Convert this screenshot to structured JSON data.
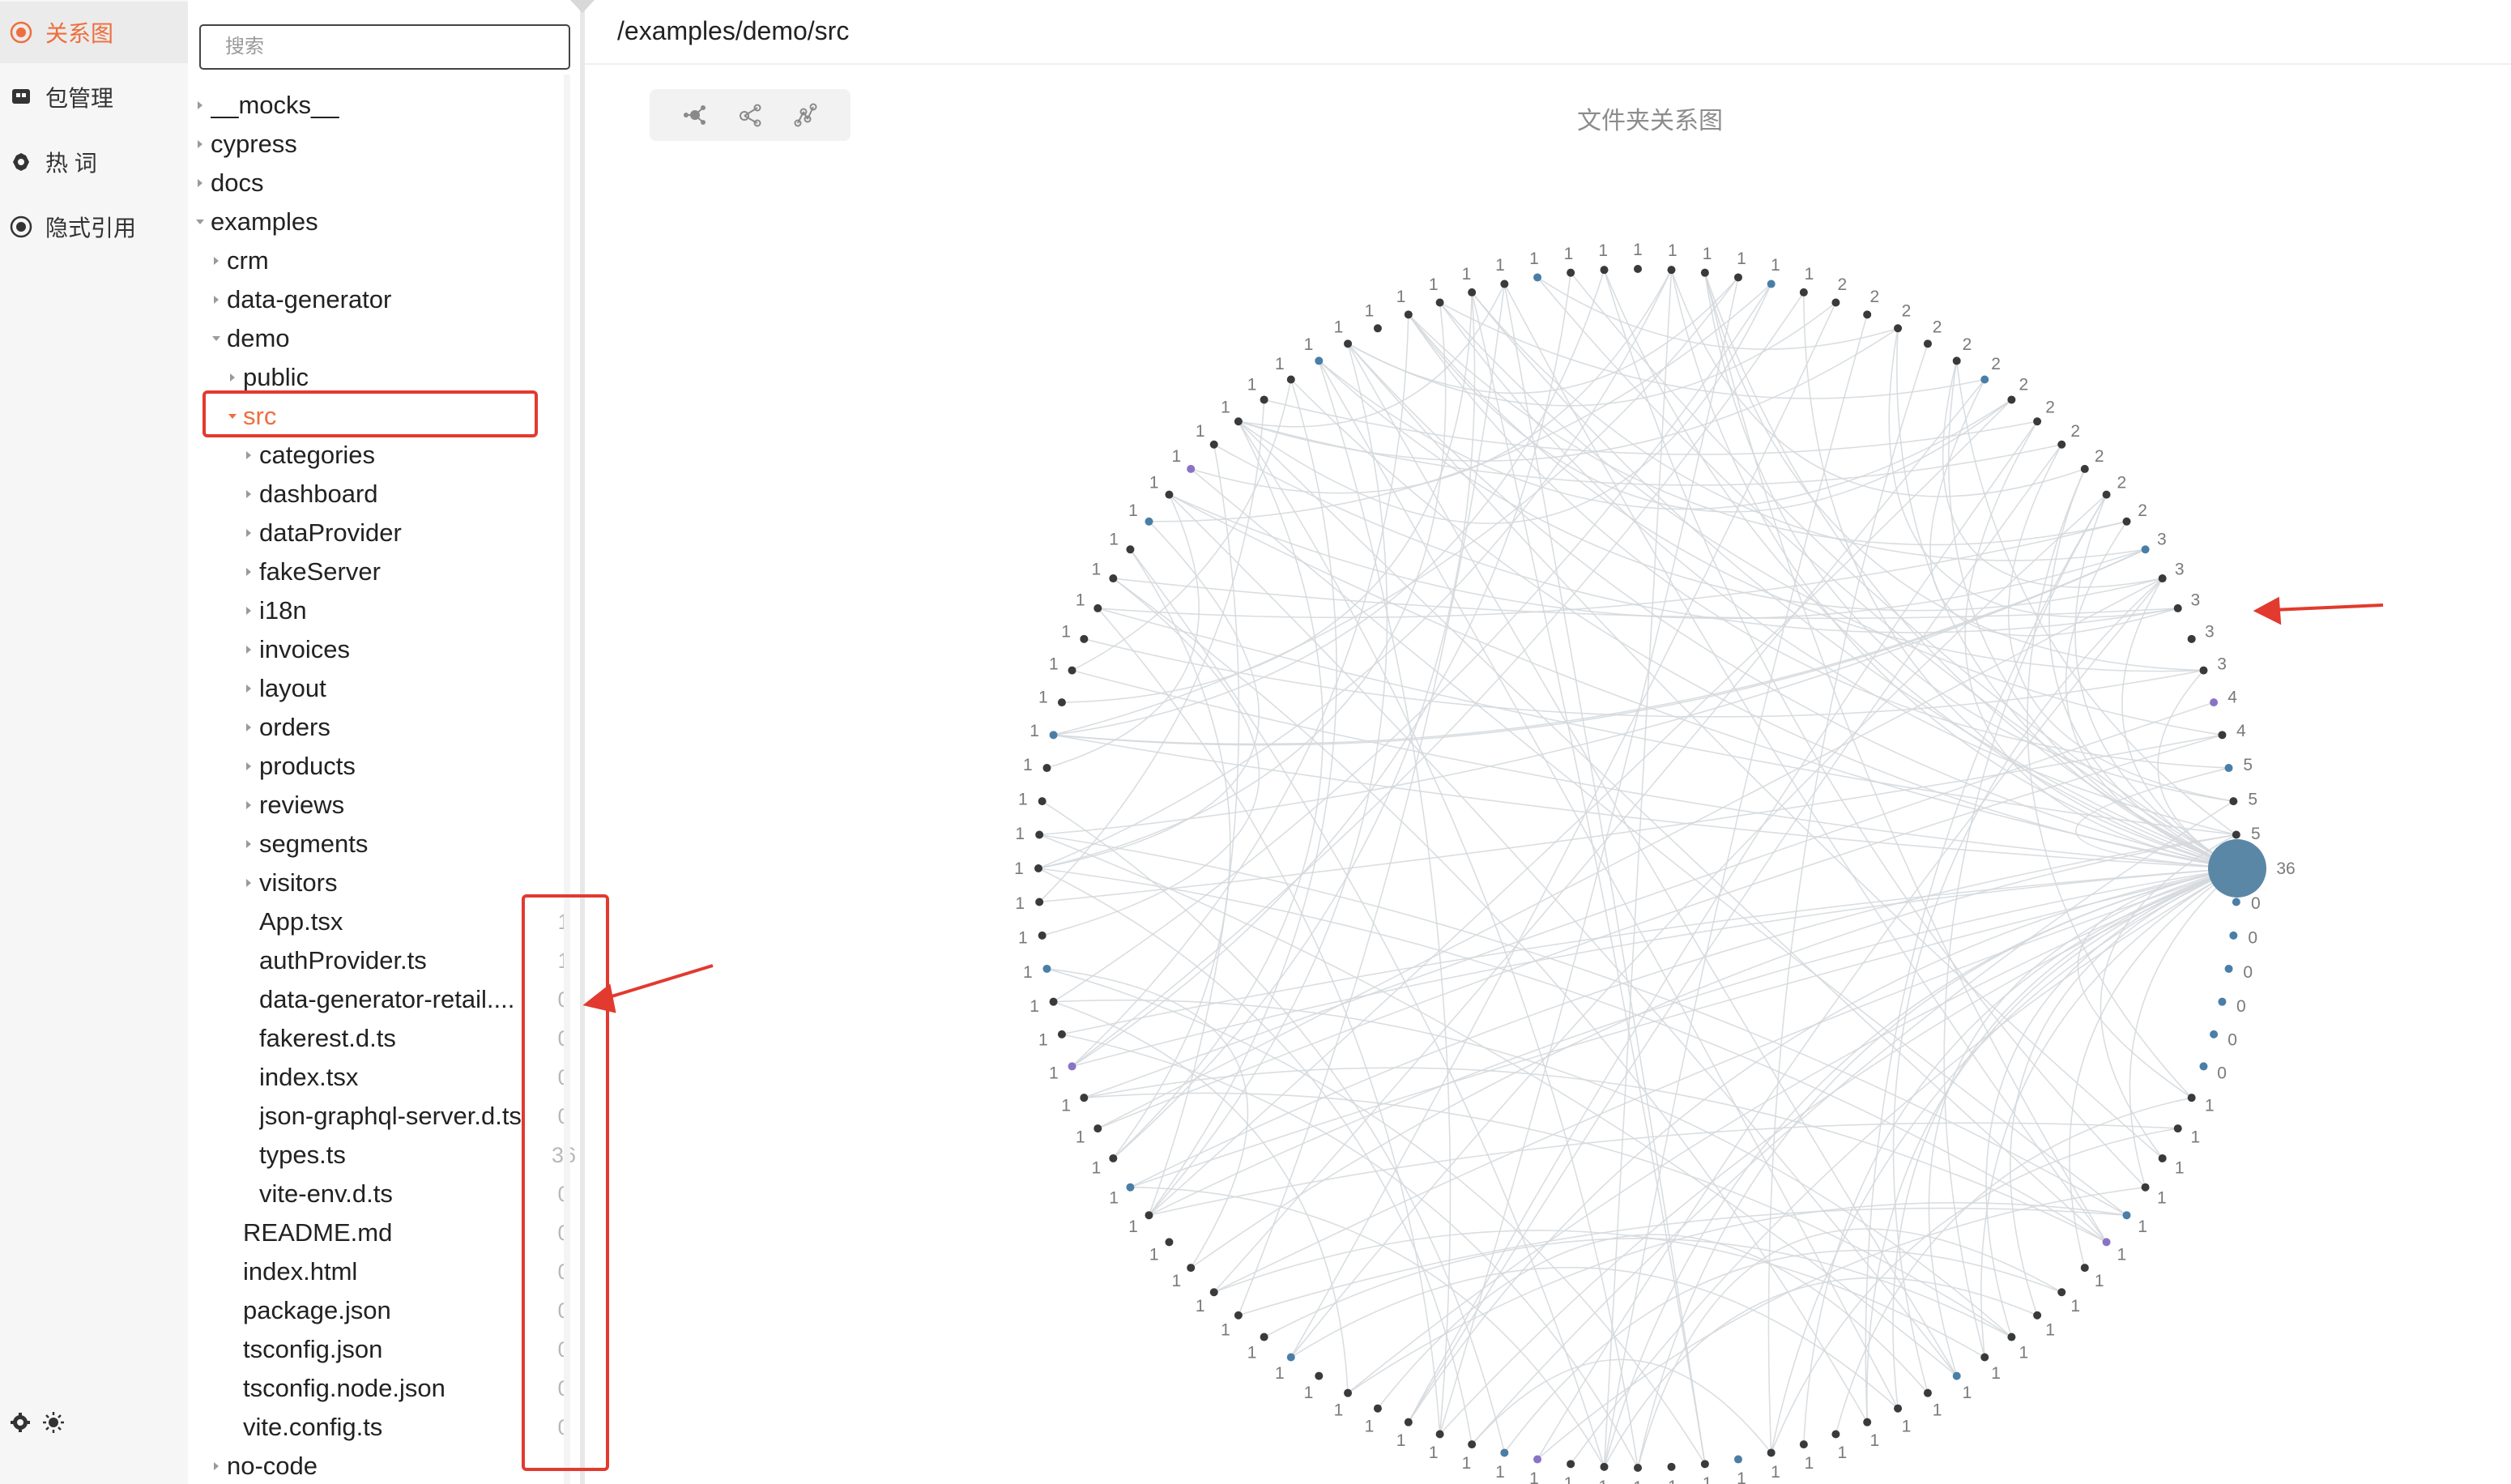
{
  "nav": {
    "items": [
      {
        "label": "关系图",
        "icon": "relation-graph-icon",
        "active": true
      },
      {
        "label": "包管理",
        "icon": "package-icon",
        "active": false
      },
      {
        "label": "热 词",
        "icon": "hot-words-icon",
        "active": false
      },
      {
        "label": "隐式引用",
        "icon": "implicit-reference-icon",
        "active": false
      }
    ],
    "bottom_icons": [
      "settings-icon",
      "theme-sun-icon"
    ]
  },
  "search": {
    "placeholder": "搜索",
    "value": ""
  },
  "tree": [
    {
      "label": "__mocks__",
      "depth": 0,
      "type": "folder",
      "expanded": false
    },
    {
      "label": "cypress",
      "depth": 0,
      "type": "folder",
      "expanded": false
    },
    {
      "label": "docs",
      "depth": 0,
      "type": "folder",
      "expanded": false
    },
    {
      "label": "examples",
      "depth": 0,
      "type": "folder",
      "expanded": true
    },
    {
      "label": "crm",
      "depth": 1,
      "type": "folder",
      "expanded": false
    },
    {
      "label": "data-generator",
      "depth": 1,
      "type": "folder",
      "expanded": false
    },
    {
      "label": "demo",
      "depth": 1,
      "type": "folder",
      "expanded": true
    },
    {
      "label": "public",
      "depth": 2,
      "type": "folder",
      "expanded": false
    },
    {
      "label": "src",
      "depth": 2,
      "type": "folder",
      "expanded": true,
      "selected": true
    },
    {
      "label": "categories",
      "depth": 3,
      "type": "folder",
      "expanded": false
    },
    {
      "label": "dashboard",
      "depth": 3,
      "type": "folder",
      "expanded": false
    },
    {
      "label": "dataProvider",
      "depth": 3,
      "type": "folder",
      "expanded": false
    },
    {
      "label": "fakeServer",
      "depth": 3,
      "type": "folder",
      "expanded": false
    },
    {
      "label": "i18n",
      "depth": 3,
      "type": "folder",
      "expanded": false
    },
    {
      "label": "invoices",
      "depth": 3,
      "type": "folder",
      "expanded": false
    },
    {
      "label": "layout",
      "depth": 3,
      "type": "folder",
      "expanded": false
    },
    {
      "label": "orders",
      "depth": 3,
      "type": "folder",
      "expanded": false
    },
    {
      "label": "products",
      "depth": 3,
      "type": "folder",
      "expanded": false
    },
    {
      "label": "reviews",
      "depth": 3,
      "type": "folder",
      "expanded": false
    },
    {
      "label": "segments",
      "depth": 3,
      "type": "folder",
      "expanded": false
    },
    {
      "label": "visitors",
      "depth": 3,
      "type": "folder",
      "expanded": false
    },
    {
      "label": "App.tsx",
      "depth": 3,
      "type": "file",
      "count": "1"
    },
    {
      "label": "authProvider.ts",
      "depth": 3,
      "type": "file",
      "count": "1"
    },
    {
      "label": "data-generator-retail....",
      "depth": 3,
      "type": "file",
      "count": "0"
    },
    {
      "label": "fakerest.d.ts",
      "depth": 3,
      "type": "file",
      "count": "0"
    },
    {
      "label": "index.tsx",
      "depth": 3,
      "type": "file",
      "count": "0"
    },
    {
      "label": "json-graphql-server.d.ts",
      "depth": 3,
      "type": "file",
      "count": "0"
    },
    {
      "label": "types.ts",
      "depth": 3,
      "type": "file",
      "count": "36"
    },
    {
      "label": "vite-env.d.ts",
      "depth": 3,
      "type": "file",
      "count": "0"
    },
    {
      "label": "README.md",
      "depth": 2,
      "type": "file",
      "count": "0"
    },
    {
      "label": "index.html",
      "depth": 2,
      "type": "file",
      "count": "0"
    },
    {
      "label": "package.json",
      "depth": 2,
      "type": "file",
      "count": "0"
    },
    {
      "label": "tsconfig.json",
      "depth": 2,
      "type": "file",
      "count": "0"
    },
    {
      "label": "tsconfig.node.json",
      "depth": 2,
      "type": "file",
      "count": "0"
    },
    {
      "label": "vite.config.ts",
      "depth": 2,
      "type": "file",
      "count": "0"
    },
    {
      "label": "no-code",
      "depth": 1,
      "type": "folder",
      "expanded": false
    }
  ],
  "main": {
    "path": "/examples/demo/src",
    "chart_title": "文件夹关系图",
    "toolbar": [
      {
        "icon": "layout-force-icon"
      },
      {
        "icon": "layout-tree-icon"
      },
      {
        "icon": "layout-path-icon"
      }
    ]
  },
  "colors": {
    "accent": "#ee6e3d",
    "node_dark": "#3a3a3a",
    "node_blue": "#4a7ea6",
    "node_purple": "#8a73c4",
    "big_node": "#5a87a6",
    "edge": "#d4d8dc",
    "annotation": "#e23a2e"
  },
  "chart_data": {
    "type": "chord",
    "title": "文件夹关系图",
    "node_labels_counterclockwise_from_big_node": [
      "36",
      "5",
      "5",
      "5",
      "4",
      "4",
      "3",
      "3",
      "3",
      "3",
      "3",
      "2",
      "2",
      "2",
      "2",
      "2",
      "2",
      "2",
      "2",
      "2",
      "2",
      "2",
      "2",
      "1",
      "1",
      "1",
      "1",
      "1",
      "1",
      "1",
      "1",
      "1",
      "1",
      "1",
      "1",
      "1",
      "1",
      "1",
      "1",
      "1",
      "1",
      "1",
      "1",
      "1",
      "1",
      "1",
      "1",
      "1",
      "1",
      "1",
      "1",
      "1",
      "1",
      "1",
      "1",
      "1",
      "1",
      "1",
      "1",
      "1",
      "1",
      "1",
      "1",
      "1",
      "1",
      "1",
      "1",
      "1",
      "1",
      "1",
      "1",
      "1",
      "1",
      "1",
      "1",
      "1",
      "1",
      "1",
      "1",
      "1",
      "1",
      "1",
      "1",
      "1",
      "1",
      "1",
      "1",
      "1",
      "1",
      "1",
      "1",
      "1",
      "1",
      "1",
      "1",
      "1",
      "1",
      "1",
      "1",
      "1",
      "1",
      "1",
      "1",
      "1",
      "1",
      "1",
      "0",
      "0",
      "0",
      "0",
      "0",
      "0"
    ]
  }
}
